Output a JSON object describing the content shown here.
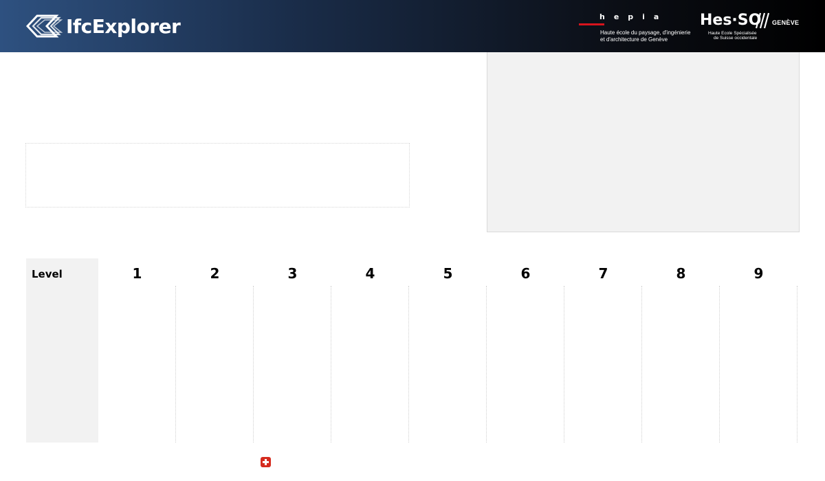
{
  "header": {
    "app_name": "IfcExplorer",
    "logo_icon": "layered-diamond-icon",
    "hepia": {
      "word": "hepia",
      "line1": "Haute école du paysage, d'ingénierie",
      "line2": "et d'architecture de Genève",
      "accent_color": "#d8141d"
    },
    "hesso": {
      "main": "Hes·SO",
      "city": "GENÈVE",
      "line1": "Haute Ecole Spécialisée",
      "line2": "de Suisse occidentale"
    }
  },
  "levels": {
    "label": "Level",
    "columns": [
      "1",
      "2",
      "3",
      "4",
      "5",
      "6",
      "7",
      "8",
      "9"
    ]
  },
  "footer": {
    "flag_icon": "swiss-flag-icon"
  }
}
